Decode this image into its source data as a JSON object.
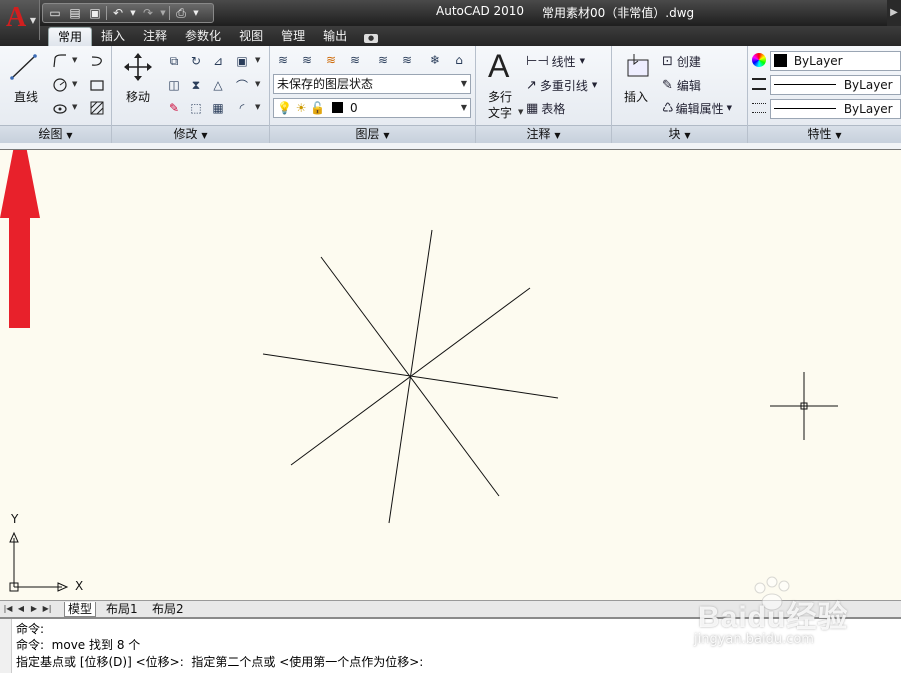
{
  "titlebar": {
    "app_name": "AutoCAD 2010",
    "document": "常用素材00（非常值）.dwg",
    "logo_letter": "A"
  },
  "ribbon_tabs": [
    "常用",
    "插入",
    "注释",
    "参数化",
    "视图",
    "管理",
    "输出"
  ],
  "active_tab": "常用",
  "panels": {
    "draw": {
      "title": "绘图",
      "line_label": "直线"
    },
    "modify": {
      "title": "修改",
      "move_label": "移动"
    },
    "layers": {
      "title": "图层",
      "layer_state": "未保存的图层状态",
      "current_layer": "0"
    },
    "annotation": {
      "title": "注释",
      "mtext_line1": "多行",
      "mtext_line2": "文字",
      "linear": "线性",
      "multileader": "多重引线",
      "table": "表格"
    },
    "block": {
      "title": "块",
      "insert": "插入",
      "create": "创建",
      "edit": "编辑",
      "edit_attributes": "编辑属性"
    },
    "properties": {
      "title": "特性",
      "color": "ByLayer",
      "linetype": "ByLayer",
      "lineweight": "ByLayer"
    }
  },
  "ucs": {
    "x_label": "X",
    "y_label": "Y"
  },
  "layout_tabs": [
    "模型",
    "布局1",
    "布局2"
  ],
  "command_lines": [
    "命令:",
    "命令:  move 找到 8 个",
    "指定基点或 [位移(D)] <位移>:  指定第二个点或 <使用第一个点作为位移>:"
  ],
  "watermark": {
    "brand": "Baidu经验",
    "url": "jingyan.baidu.com"
  },
  "colors": {
    "canvas": "#fdfbf0",
    "annotation_arrow": "#e8212b",
    "logo": "#d21f1f"
  }
}
